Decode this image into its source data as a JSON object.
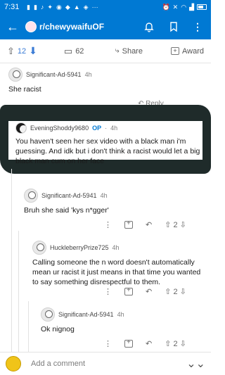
{
  "status": {
    "time": "7:31"
  },
  "header": {
    "subreddit": "r/chewywaifuOF"
  },
  "post_actions": {
    "votes": "12",
    "comments": "62",
    "share": "Share",
    "award": "Award"
  },
  "comments": [
    {
      "user": "Significant-Ad-5941",
      "age": "4h",
      "text": "She racist",
      "reply": "Reply"
    },
    {
      "user": "EveningShoddy9680",
      "op_badge": "OP",
      "age": "4h",
      "text": "You haven't seen her sex video with a black man i'm guessing. And idk but i don't think a racist would let a big black man cum on her face"
    },
    {
      "user": "Significant-Ad-5941",
      "age": "4h",
      "text": "Bruh she said 'kys n*gger'",
      "votes": "2"
    },
    {
      "user": "HuckleberryPrize725",
      "age": "4h",
      "text": "Calling someone the n word doesn't automatically mean ur racist it just means in that time you wanted to say something disrespectful to them.",
      "votes": "2"
    },
    {
      "user": "Significant-Ad-5941",
      "age": "4h",
      "text": "Ok nignog",
      "votes": "2"
    }
  ],
  "composer": {
    "placeholder": "Add a comment"
  }
}
